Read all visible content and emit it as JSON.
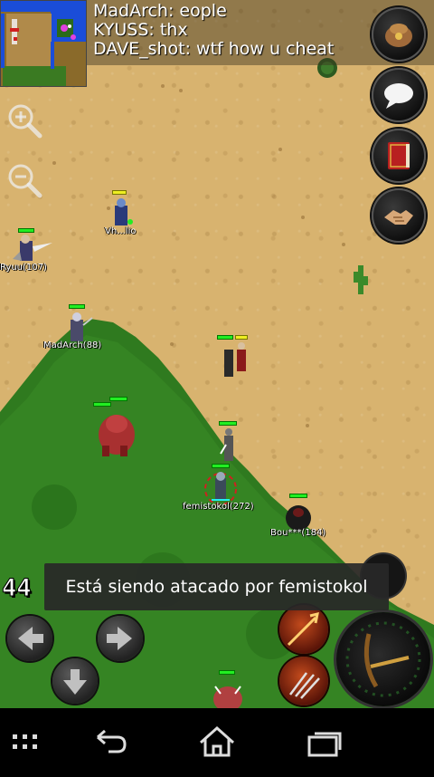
{
  "chat": {
    "lines": [
      "MadArch: eople",
      "KYUSS: thx",
      "DAVE_shot: wtf how u cheat"
    ]
  },
  "characters": [
    {
      "id": "ryuu",
      "name": "Ryuu(107)"
    },
    {
      "id": "player-top",
      "name": "Vh...lio"
    },
    {
      "id": "madarch",
      "name": "MadArch(88)"
    },
    {
      "id": "femistokol",
      "name": "femistokol(272)"
    },
    {
      "id": "bourt",
      "name": "Bou***(184)"
    }
  ],
  "toast": {
    "message": "Está siendo atacado por femistokol"
  },
  "hud": {
    "counter": "44"
  },
  "colors": {
    "sand": "#d8b36f",
    "grass": "#2f7a1f",
    "chat_bg": "rgba(60,50,30,0.45)",
    "toast_bg": "#282828",
    "hp_bar": "#22ee22"
  },
  "icons": {
    "side_buttons": [
      "bag-icon",
      "chat-bubble-icon",
      "spellbook-icon",
      "handshake-icon"
    ],
    "zoom": [
      "zoom-in-icon",
      "zoom-out-icon"
    ],
    "nav": [
      "recent-apps-icon",
      "back-icon",
      "home-icon",
      "overview-icon"
    ]
  }
}
